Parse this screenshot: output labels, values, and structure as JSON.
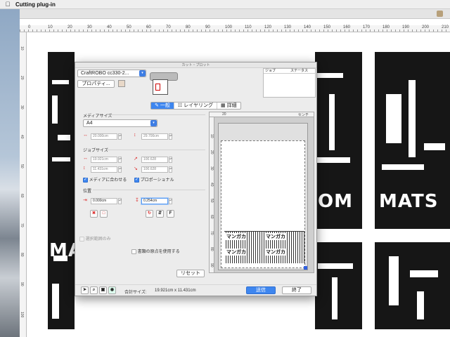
{
  "menubar": {
    "app_name": "Cutting plug-in"
  },
  "artwork": {
    "word_a": "MA",
    "word_b": "OM",
    "word_c": "MATS"
  },
  "ruler": {
    "h_ticks": [
      "0",
      "10",
      "20",
      "30",
      "40",
      "50",
      "60",
      "70",
      "80",
      "90",
      "100",
      "110",
      "120",
      "130",
      "140",
      "150",
      "160",
      "170",
      "180",
      "190",
      "200",
      "210"
    ],
    "v_ticks": [
      "10",
      "20",
      "30",
      "40",
      "50",
      "60",
      "70",
      "80",
      "90",
      "100"
    ]
  },
  "dialog": {
    "title": "カット・プロット",
    "device": "CraftROBO cc330-2...",
    "properties_button": "プロパティ...",
    "job_header": "ジョブ",
    "status_header": "ステータス",
    "tabs": [
      {
        "label": "一般",
        "icon": "pen-icon"
      },
      {
        "label": "レイヤリング",
        "icon": "layers-icon"
      },
      {
        "label": "詳細",
        "icon": "detail-icon"
      }
    ],
    "media_size_label": "メディアサイズ",
    "media_size_value": "A4",
    "media_width": "20.000cm",
    "media_height": "29.700cm",
    "job_size_label": "ジョブサイズ",
    "job_width": "19.921cm",
    "job_height": "11.431cm",
    "scale_w": "100.628",
    "scale_h": "100.628",
    "fit_media_label": "メディアに合わせる",
    "proportional_label": "プロポーショナル",
    "position_label": "位置",
    "pos_x": "0.000cm",
    "pos_y": "0.254cm",
    "selection_only_label": "選択範囲のみ",
    "use_doc_origin_label": "書類の原点を使用する",
    "reset_button": "リセット",
    "total_size_label": "合計サイズ:",
    "total_size_value": "19.921cm x 11.431cm",
    "send_button": "送信",
    "close_button": "終了",
    "preview_ruler_h": [
      "20",
      "センチ"
    ],
    "preview_ruler_v": [
      "10",
      "20",
      "30",
      "40",
      "50",
      "60",
      "70",
      "80",
      "90"
    ],
    "preview_cut_text": [
      "マンガカ",
      "マンガカ",
      "マンガカ",
      "マンガカ"
    ]
  }
}
